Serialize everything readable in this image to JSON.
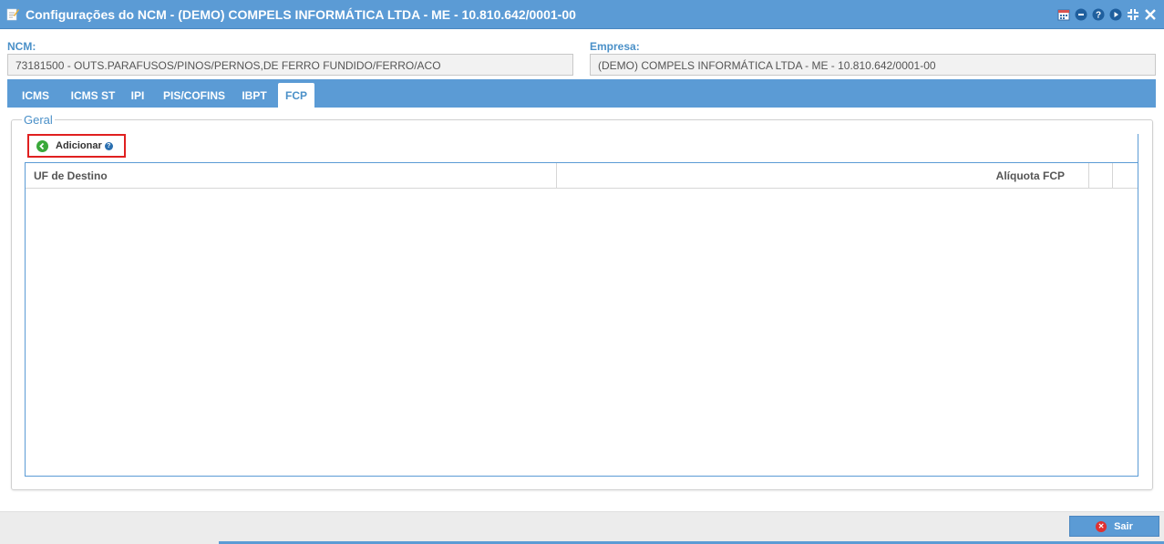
{
  "window": {
    "title": "Configurações do NCM - (DEMO) COMPELS INFORMÁTICA LTDA - ME - 10.810.642/0001-00",
    "title_icon": "edit-icon",
    "controls": [
      "calendar-icon",
      "minimize-icon",
      "help-icon",
      "next-icon",
      "collapse-icon",
      "close-icon"
    ]
  },
  "ncm": {
    "label": "NCM:",
    "value": "73181500 - OUTS.PARAFUSOS/PINOS/PERNOS,DE FERRO FUNDIDO/FERRO/ACO"
  },
  "empresa": {
    "label": "Empresa:",
    "value": "(DEMO) COMPELS INFORMÁTICA LTDA - ME - 10.810.642/0001-00"
  },
  "tabs": [
    {
      "label": "ICMS",
      "active": false
    },
    {
      "label": "ICMS ST",
      "active": false
    },
    {
      "label": "IPI",
      "active": false
    },
    {
      "label": "PIS/COFINS",
      "active": false
    },
    {
      "label": "IBPT",
      "active": false
    },
    {
      "label": "FCP",
      "active": true
    }
  ],
  "section": {
    "legend": "Geral",
    "add_button": "Adicionar",
    "help_glyph": "?"
  },
  "grid": {
    "columns": [
      "UF de Destino",
      "Alíquota FCP",
      "",
      ""
    ],
    "rows": []
  },
  "footer": {
    "exit_button": "Sair"
  },
  "colors": {
    "accent": "#5b9bd5",
    "label": "#4a90c8",
    "highlight": "#e02020"
  }
}
